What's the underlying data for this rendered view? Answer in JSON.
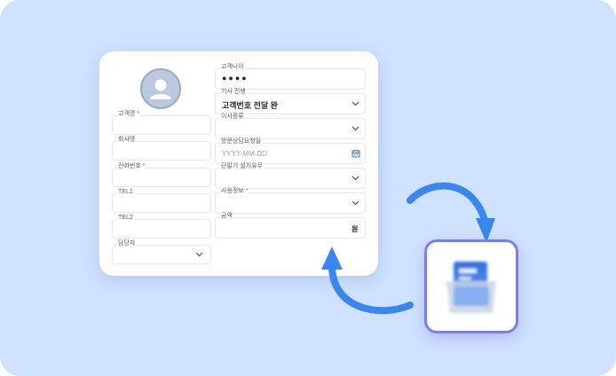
{
  "form": {
    "fields": {
      "customer_name": {
        "label": "고객명",
        "required": "*"
      },
      "company_name": {
        "label": "회사명"
      },
      "phone": {
        "label": "전화번호",
        "required": "*"
      },
      "tel1": {
        "label": "TEL1"
      },
      "tel2": {
        "label": "TEL2"
      },
      "manager": {
        "label": "담당자"
      },
      "customer_age": {
        "label": "고객나이",
        "value": "●●●●"
      },
      "technician_progress": {
        "label": "기사 진행",
        "value": "고객번호 전달 완"
      },
      "move_type": {
        "label": "이사종류"
      },
      "visit_date": {
        "label": "방문상담요청일",
        "placeholder": "YYYY-MM-DD"
      },
      "aircon_install": {
        "label": "단말기 설치유무"
      },
      "usage_info": {
        "label": "사용정보",
        "required": "*"
      },
      "amount": {
        "label": "금액",
        "unit": "원"
      }
    }
  },
  "icons": {
    "avatar": "user-avatar-icon",
    "chevron": "chevron-down-icon",
    "calendar": "calendar-icon",
    "app": "document-stack-app-icon"
  },
  "colors": {
    "background": "#cfe2ff",
    "arrow": "#3a86f0",
    "app_border": "#7b7cf0",
    "required": "#e34b4b"
  }
}
